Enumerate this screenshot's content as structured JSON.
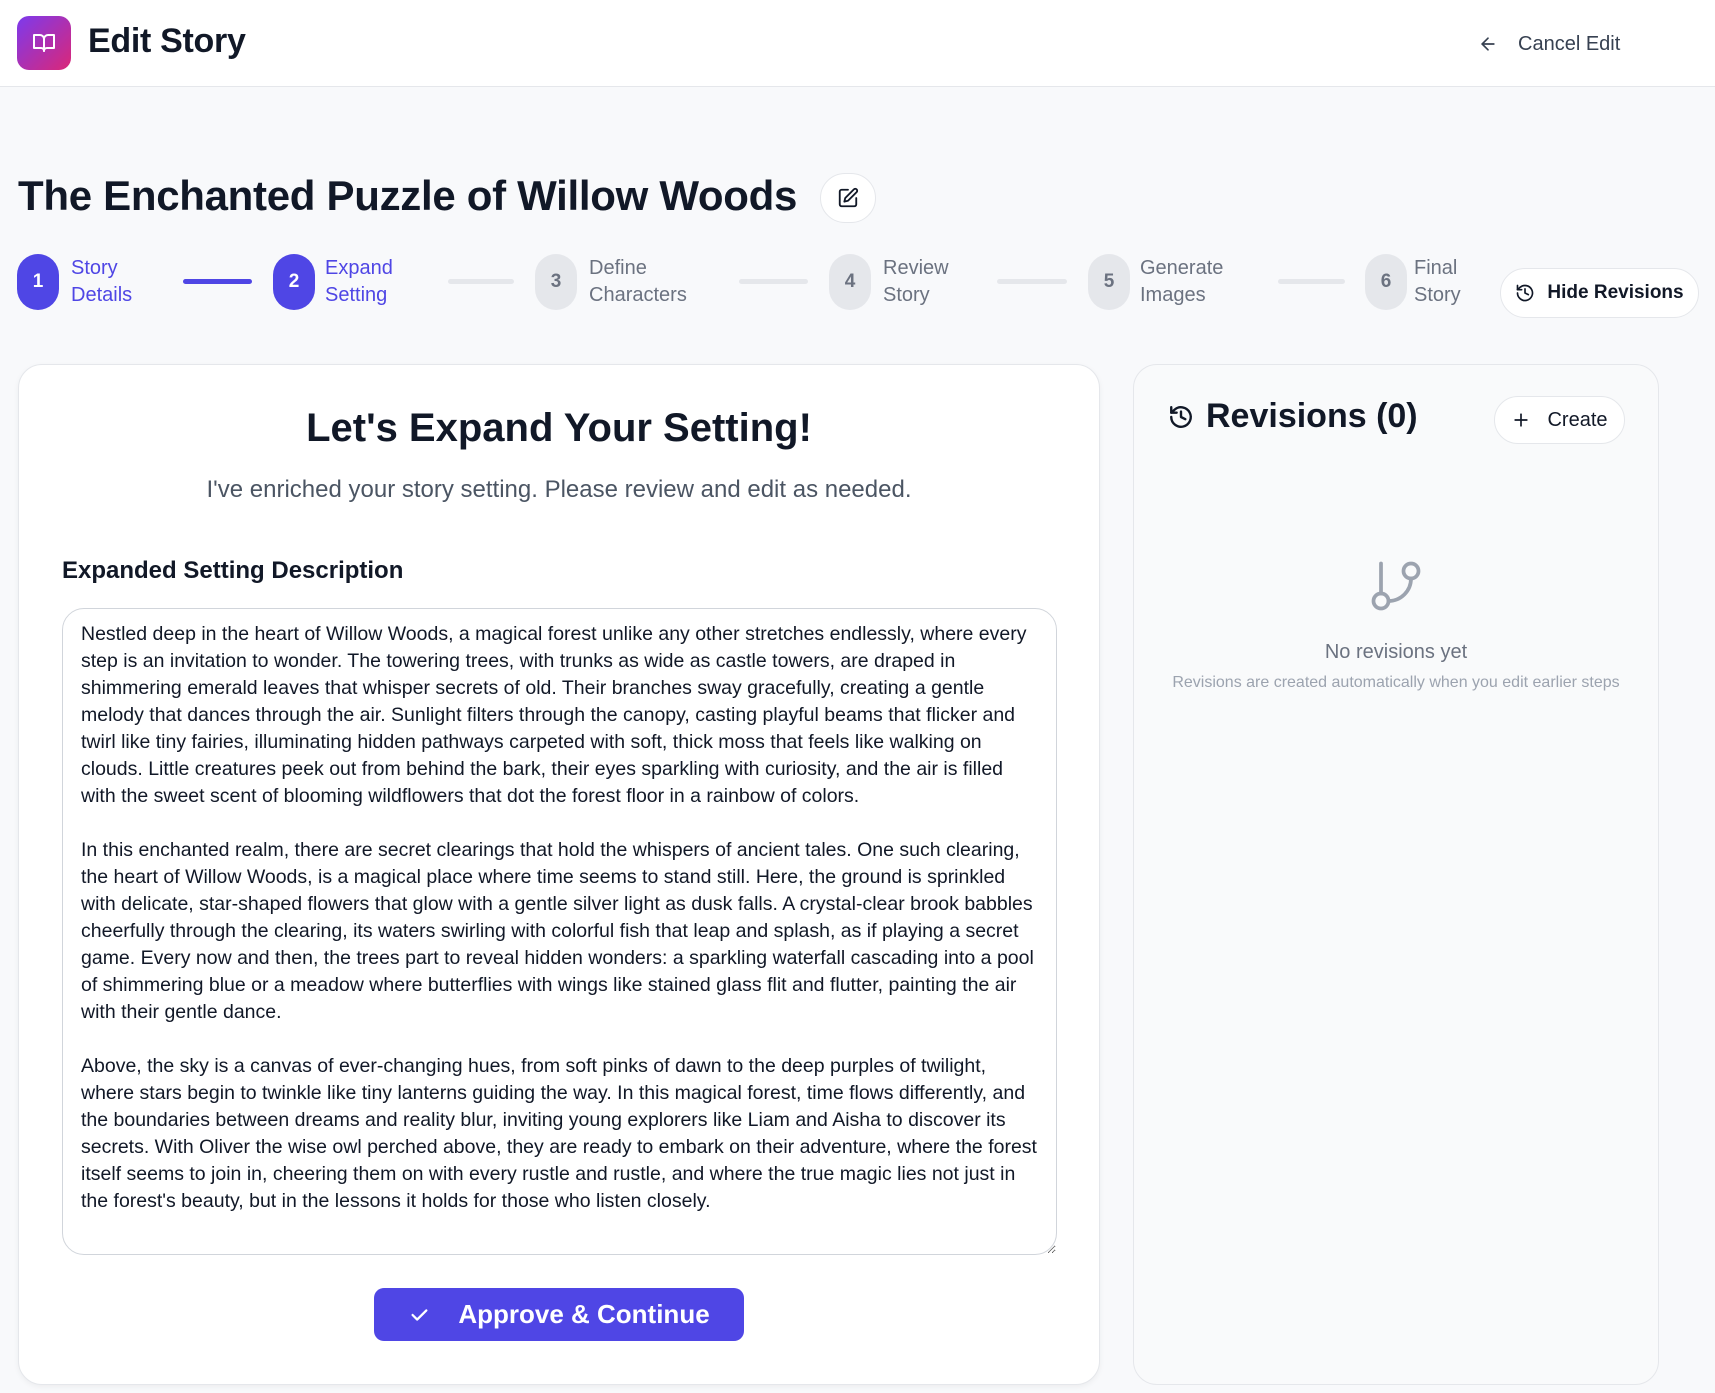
{
  "header": {
    "app_title": "Edit Story",
    "logo_icon": "book-open-icon",
    "cancel_label": "Cancel Edit"
  },
  "story": {
    "title": "The Enchanted Puzzle of Willow Woods"
  },
  "stepper": {
    "steps": [
      {
        "number": "1",
        "line1": "Story",
        "line2": "Details",
        "state": "done"
      },
      {
        "number": "2",
        "line1": "Expand",
        "line2": "Setting",
        "state": "current"
      },
      {
        "number": "3",
        "line1": "Define",
        "line2": "Characters",
        "state": "upcoming"
      },
      {
        "number": "4",
        "line1": "Review",
        "line2": "Story",
        "state": "upcoming"
      },
      {
        "number": "5",
        "line1": "Generate",
        "line2": "Images",
        "state": "upcoming"
      },
      {
        "number": "6",
        "line1": "Final",
        "line2": "Story",
        "state": "upcoming"
      }
    ],
    "hide_revisions_label": "Hide Revisions"
  },
  "main": {
    "heading": "Let's Expand Your Setting!",
    "subheading": "I've enriched your story setting. Please review and edit as needed.",
    "field_label": "Expanded Setting Description",
    "setting_text": "Nestled deep in the heart of Willow Woods, a magical forest unlike any other stretches endlessly, where every step is an invitation to wonder. The towering trees, with trunks as wide as castle towers, are draped in shimmering emerald leaves that whisper secrets of old. Their branches sway gracefully, creating a gentle melody that dances through the air. Sunlight filters through the canopy, casting playful beams that flicker and twirl like tiny fairies, illuminating hidden pathways carpeted with soft, thick moss that feels like walking on clouds. Little creatures peek out from behind the bark, their eyes sparkling with curiosity, and the air is filled with the sweet scent of blooming wildflowers that dot the forest floor in a rainbow of colors.\n\nIn this enchanted realm, there are secret clearings that hold the whispers of ancient tales. One such clearing, the heart of Willow Woods, is a magical place where time seems to stand still. Here, the ground is sprinkled with delicate, star-shaped flowers that glow with a gentle silver light as dusk falls. A crystal-clear brook babbles cheerfully through the clearing, its waters swirling with colorful fish that leap and splash, as if playing a secret game. Every now and then, the trees part to reveal hidden wonders: a sparkling waterfall cascading into a pool of shimmering blue or a meadow where butterflies with wings like stained glass flit and flutter, painting the air with their gentle dance.\n\nAbove, the sky is a canvas of ever-changing hues, from soft pinks of dawn to the deep purples of twilight, where stars begin to twinkle like tiny lanterns guiding the way. In this magical forest, time flows differently, and the boundaries between dreams and reality blur, inviting young explorers like Liam and Aisha to discover its secrets. With Oliver the wise owl perched above, they are ready to embark on their adventure, where the forest itself seems to join in, cheering them on with every rustle and rustle, and where the true magic lies not just in the forest's beauty, but in the lessons it holds for those who listen closely.",
    "approve_label": "Approve & Continue"
  },
  "revisions": {
    "title": "Revisions (0)",
    "create_label": "Create",
    "empty_title": "No revisions yet",
    "empty_subtitle": "Revisions are created automatically when you edit earlier steps"
  },
  "colors": {
    "accent": "#4f46e5",
    "inactive_step": "#e5e7eb",
    "logo_gradient_start": "#7c3aed",
    "logo_gradient_end": "#db2777"
  }
}
